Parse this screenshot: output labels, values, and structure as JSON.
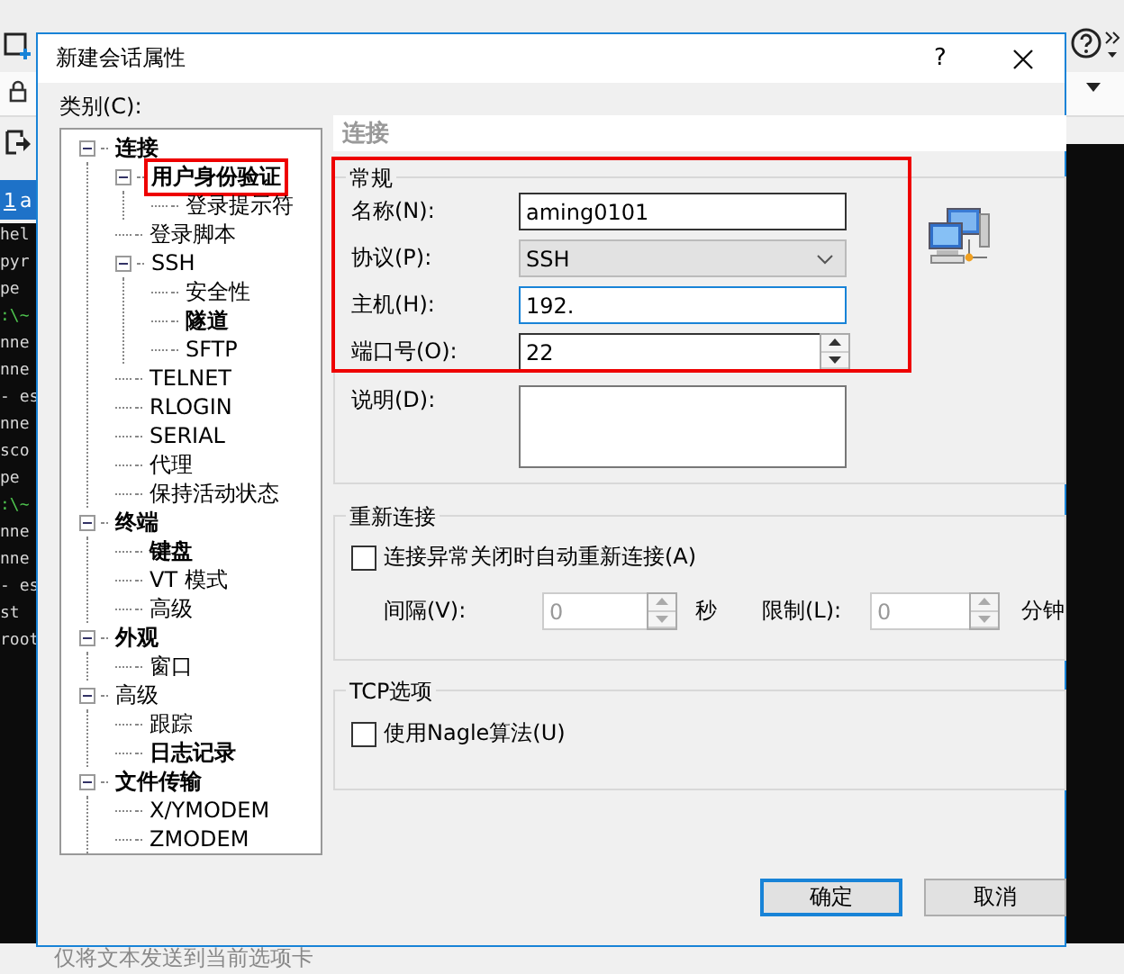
{
  "background": {
    "tab": {
      "number": "1",
      "label": "a"
    },
    "terminal_lines": [
      {
        "text": "hel",
        "kind": "output"
      },
      {
        "text": "pyr",
        "kind": "output"
      },
      {
        "text": "pe",
        "kind": "output"
      },
      {
        "text": ":\\~",
        "kind": "prompt"
      },
      {
        "text": "nne",
        "kind": "output"
      },
      {
        "text": "nne",
        "kind": "output"
      },
      {
        "text": "- es",
        "kind": "output"
      },
      {
        "text": "nne",
        "kind": "output"
      },
      {
        "text": "sco",
        "kind": "output"
      },
      {
        "text": "pe",
        "kind": "output"
      },
      {
        "text": ":\\~",
        "kind": "prompt"
      },
      {
        "text": "nne",
        "kind": "output"
      },
      {
        "text": "nne",
        "kind": "output"
      },
      {
        "text": "- es",
        "kind": "output"
      },
      {
        "text": "st",
        "kind": "output"
      },
      {
        "text": "root",
        "kind": "output"
      }
    ],
    "status_bar": "仅将文本发送到当前选项卡"
  },
  "dialog": {
    "title": "新建会话属性",
    "help": "?",
    "category_label": "类别(C):",
    "tree": [
      {
        "label": "连接",
        "bold": true,
        "expanded": true,
        "annotated": false,
        "children": [
          {
            "label": "用户身份验证",
            "bold": true,
            "expanded": true,
            "annotated": true,
            "children": [
              {
                "label": "登录提示符",
                "bold": false,
                "annotated": false
              }
            ]
          },
          {
            "label": "登录脚本",
            "bold": false,
            "annotated": false
          },
          {
            "label": "SSH",
            "bold": false,
            "expanded": true,
            "annotated": false,
            "children": [
              {
                "label": "安全性",
                "bold": false,
                "annotated": false
              },
              {
                "label": "隧道",
                "bold": true,
                "annotated": false
              },
              {
                "label": "SFTP",
                "bold": false,
                "annotated": false
              }
            ]
          },
          {
            "label": "TELNET",
            "bold": false,
            "annotated": false
          },
          {
            "label": "RLOGIN",
            "bold": false,
            "annotated": false
          },
          {
            "label": "SERIAL",
            "bold": false,
            "annotated": false
          },
          {
            "label": "代理",
            "bold": false,
            "annotated": false
          },
          {
            "label": "保持活动状态",
            "bold": false,
            "annotated": false
          }
        ]
      },
      {
        "label": "终端",
        "bold": true,
        "expanded": true,
        "annotated": false,
        "children": [
          {
            "label": "键盘",
            "bold": true,
            "annotated": false
          },
          {
            "label": "VT 模式",
            "bold": false,
            "annotated": false
          },
          {
            "label": "高级",
            "bold": false,
            "annotated": false
          }
        ]
      },
      {
        "label": "外观",
        "bold": true,
        "expanded": true,
        "annotated": false,
        "children": [
          {
            "label": "窗口",
            "bold": false,
            "annotated": false
          }
        ]
      },
      {
        "label": "高级",
        "bold": false,
        "expanded": true,
        "annotated": false,
        "children": [
          {
            "label": "跟踪",
            "bold": false,
            "annotated": false
          },
          {
            "label": "日志记录",
            "bold": true,
            "annotated": false
          }
        ]
      },
      {
        "label": "文件传输",
        "bold": true,
        "expanded": true,
        "annotated": false,
        "children": [
          {
            "label": "X/YMODEM",
            "bold": false,
            "annotated": false
          },
          {
            "label": "ZMODEM",
            "bold": false,
            "annotated": false
          }
        ]
      }
    ],
    "panel_title": "连接",
    "general": {
      "title": "常规",
      "annotated": true,
      "fields": [
        {
          "label": "名称(N):",
          "kind": "text",
          "value": "aming0101",
          "focused": false
        },
        {
          "label": "协议(P):",
          "kind": "select",
          "value": "SSH",
          "focused": false
        },
        {
          "label": "主机(H):",
          "kind": "text",
          "value": "192.",
          "focused": true
        },
        {
          "label": "端口号(O):",
          "kind": "spin",
          "value": "22",
          "focused": false
        }
      ],
      "description_label": "说明(D):"
    },
    "reconnect": {
      "title": "重新连接",
      "checkbox": {
        "label": "连接异常关闭时自动重新连接(A)",
        "checked": false
      },
      "interval_label": "间隔(V):",
      "interval_value": "0",
      "interval_unit": "秒",
      "limit_label": "限制(L):",
      "limit_value": "0",
      "limit_unit": "分钟",
      "disabled": true
    },
    "tcp": {
      "title": "TCP选项",
      "checkbox": {
        "label": "使用Nagle算法(U)",
        "checked": false
      }
    },
    "buttons": [
      {
        "label": "确定",
        "default": true
      },
      {
        "label": "取消",
        "default": false
      }
    ]
  }
}
